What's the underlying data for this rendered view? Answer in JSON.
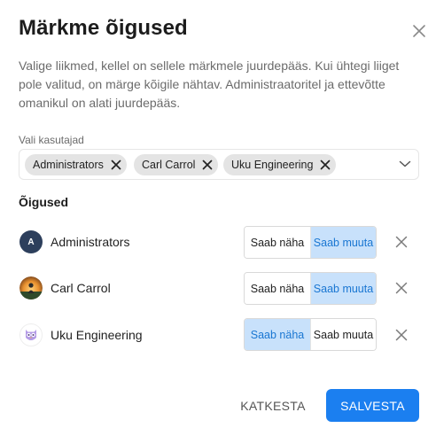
{
  "dialog": {
    "title": "Märkme õigused",
    "description": "Valige liikmed, kellel on sellele märkmele juurdepääs. Kui ühtegi liiget pole valitud, on märge kõigile nähtav. Administraatoritel ja ettevõtte omanikul on alati juurdepääs.",
    "close_icon": "close-icon"
  },
  "user_select": {
    "label": "Vali kasutajad",
    "chips": [
      {
        "label": "Administrators"
      },
      {
        "label": "Carl Carrol"
      },
      {
        "label": "Uku Engineering"
      }
    ],
    "dropdown_icon": "chevron-down-icon"
  },
  "permissions": {
    "heading": "Õigused",
    "view_label": "Saab näha",
    "edit_label": "Saab muuta",
    "rows": [
      {
        "name": "Administrators",
        "avatar_letter": "A",
        "active": "edit"
      },
      {
        "name": "Carl Carrol",
        "avatar": "photo",
        "active": "edit"
      },
      {
        "name": "Uku Engineering",
        "avatar": "owl-logo",
        "active": "view"
      }
    ]
  },
  "footer": {
    "cancel_label": "KATKESTA",
    "save_label": "SALVESTA"
  },
  "colors": {
    "primary": "#1b7ff0",
    "active_segment_bg": "#c8e1fb",
    "active_segment_text": "#1976d2"
  }
}
